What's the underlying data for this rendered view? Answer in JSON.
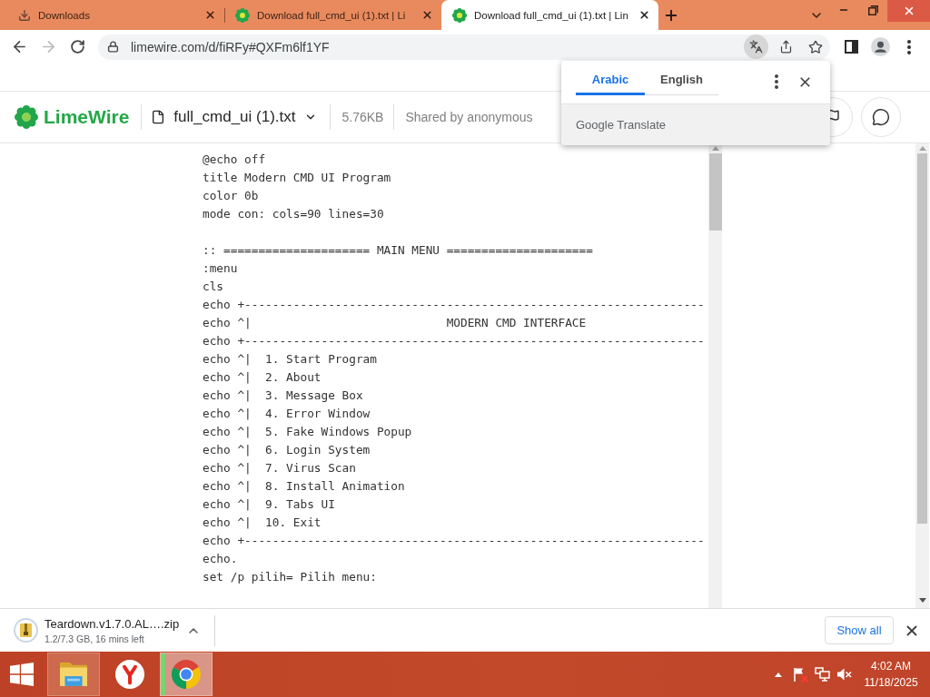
{
  "browser": {
    "tabs": [
      {
        "kind": "downloads",
        "title": "Downloads",
        "selected": false
      },
      {
        "kind": "page",
        "title": "Download full_cmd_ui (1).txt | Li",
        "selected": false
      },
      {
        "kind": "page",
        "title": "Download full_cmd_ui (1).txt | Lin",
        "selected": true
      }
    ],
    "toolbar": {
      "can_go_forward": false,
      "url": "limewire.com/d/fiRFy#QXFm6lf1YF",
      "translate_active": true
    }
  },
  "page": {
    "header": {
      "brand": "LimeWire",
      "file_name": "full_cmd_ui (1).txt",
      "file_size": "5.76KB",
      "shared_by": "Shared by anonymous"
    },
    "code_blocks": [
      [
        "@echo off",
        "title Modern CMD UI Program",
        "color 0b",
        "mode con: cols=90 lines=30"
      ],
      [
        ":: ===================== MAIN MENU =====================",
        ":menu",
        "cls",
        "echo +------------------------------------------------------------------",
        "echo ^|                            MODERN CMD INTERFACE",
        "echo +------------------------------------------------------------------",
        "echo ^|  1. Start Program",
        "echo ^|  2. About",
        "echo ^|  3. Message Box",
        "echo ^|  4. Error Window",
        "echo ^|  5. Fake Windows Popup",
        "echo ^|  6. Login System",
        "echo ^|  7. Virus Scan",
        "echo ^|  8. Install Animation",
        "echo ^|  9. Tabs UI",
        "echo ^|  10. Exit",
        "echo +------------------------------------------------------------------",
        "echo.",
        "set /p pilih= Pilih menu:"
      ]
    ]
  },
  "translate_popup": {
    "tabs": [
      {
        "label": "Arabic",
        "selected": true
      },
      {
        "label": "English",
        "selected": false
      }
    ],
    "footer": "Google Translate"
  },
  "downloads_bar": {
    "items": [
      {
        "name": "Teardown.v1.7.0.AL….zip",
        "status": "1.2/7.3 GB, 16 mins left"
      }
    ],
    "show_all": "Show all"
  },
  "taskbar": {
    "apps": [
      {
        "kind": "file_explorer",
        "running": true,
        "selected": false
      },
      {
        "kind": "yandex",
        "running": false,
        "selected": false
      },
      {
        "kind": "chrome",
        "running": true,
        "selected": true,
        "level": 0.09
      }
    ],
    "tray": {
      "action_center_alert": true,
      "volume_muted": true,
      "time": "4:02 AM",
      "date": "11/18/2025"
    }
  }
}
